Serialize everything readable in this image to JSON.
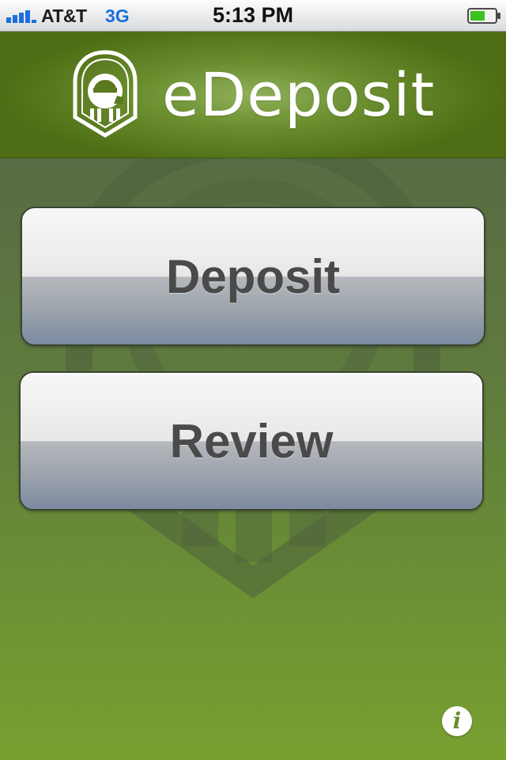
{
  "status_bar": {
    "carrier": "AT&T",
    "network": "3G",
    "time": "5:13 PM",
    "signal_bars": 4
  },
  "header": {
    "app_name": "eDeposit",
    "logo_letter": "e"
  },
  "main": {
    "buttons": [
      {
        "label": "Deposit"
      },
      {
        "label": "Review"
      }
    ],
    "info_glyph": "i"
  },
  "colors": {
    "header_green": "#6b8e2f",
    "background_green": "#6a8f35",
    "button_text": "#4a4a4a",
    "network_blue": "#1d6ee0",
    "battery_green": "#3cc21f"
  },
  "icons": [
    "signal-strength-icon",
    "battery-icon",
    "edeposit-logo-icon",
    "info-icon"
  ]
}
